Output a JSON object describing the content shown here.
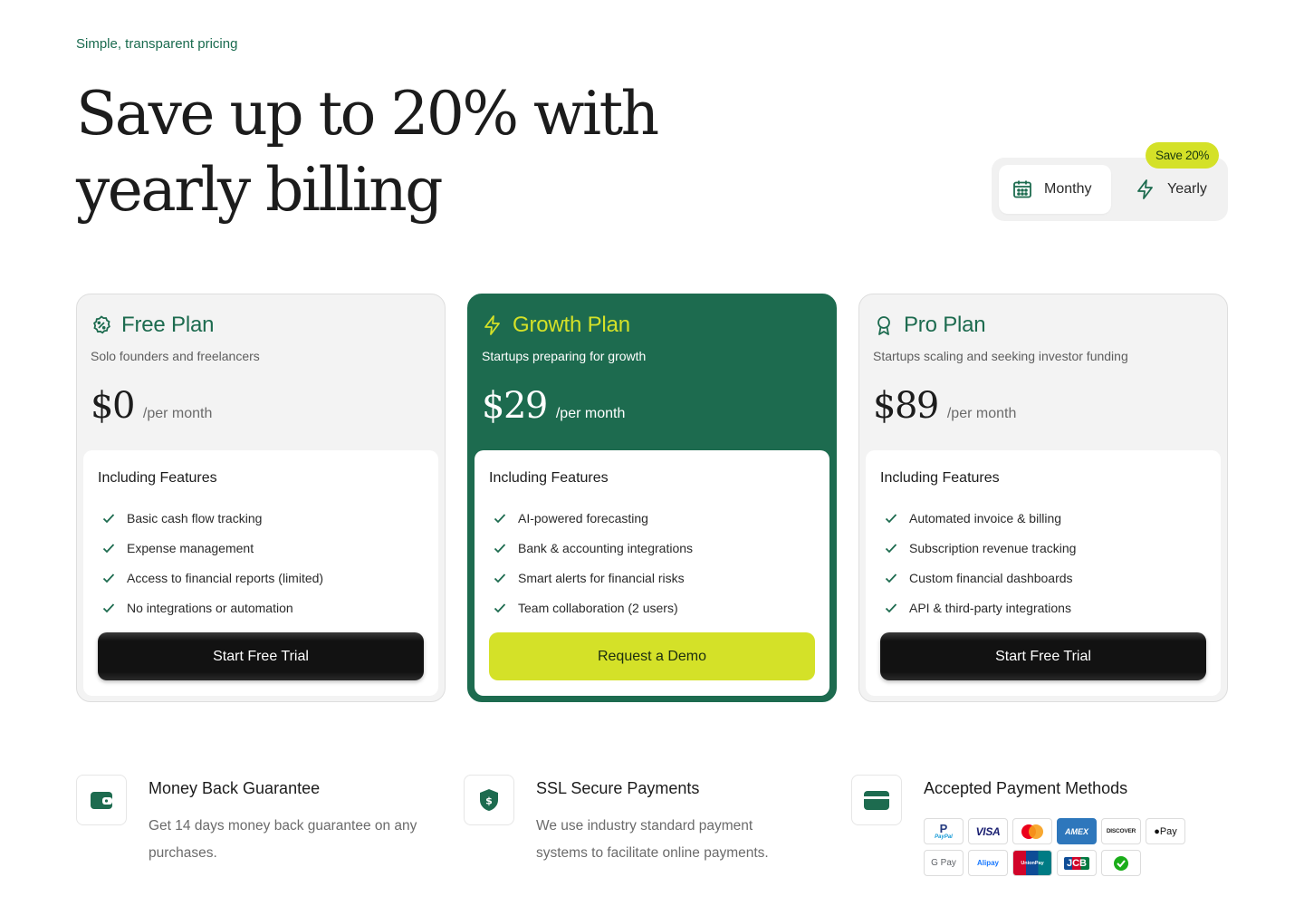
{
  "header": {
    "eyebrow": "Simple, transparent pricing",
    "title_line1": "Save up to 20% with",
    "title_line2": "yearly billing"
  },
  "billing_toggle": {
    "monthly_label": "Monthy",
    "yearly_label": "Yearly",
    "badge": "Save 20%",
    "selected": "Monthy"
  },
  "plans": [
    {
      "name": "Free Plan",
      "icon": "badge-percent-icon",
      "description": "Solo founders and freelancers",
      "price": "$0",
      "period": "/per month",
      "features_title": "Including Features",
      "features": [
        "Basic cash flow tracking",
        "Expense management",
        "Access to financial reports (limited)",
        "No integrations or automation"
      ],
      "cta": "Start Free Trial"
    },
    {
      "name": "Growth Plan",
      "icon": "lightning-icon",
      "description": "Startups preparing for growth",
      "price": "$29",
      "period": "/per month",
      "features_title": "Including Features",
      "features": [
        "AI-powered forecasting",
        "Bank & accounting integrations",
        "Smart alerts for financial risks",
        "Team collaboration (2 users)"
      ],
      "cta": "Request a Demo"
    },
    {
      "name": "Pro Plan",
      "icon": "award-icon",
      "description": "Startups scaling and seeking investor funding",
      "price": "$89",
      "period": "/per month",
      "features_title": "Including Features",
      "features": [
        "Automated invoice & billing",
        "Subscription revenue tracking",
        "Custom financial dashboards",
        "API & third-party integrations"
      ],
      "cta": "Start Free Trial"
    }
  ],
  "info": {
    "money": {
      "title": "Money Back Guarantee",
      "text": "Get 14 days money back guarantee on any purchases."
    },
    "ssl": {
      "title": "SSL Secure Payments",
      "text": "We use industry standard payment systems to facilitate online payments."
    },
    "pay": {
      "title": "Accepted Payment Methods",
      "methods": [
        {
          "name": "PayPal",
          "label": "PayPal"
        },
        {
          "name": "Visa",
          "label": "VISA"
        },
        {
          "name": "Mastercard",
          "label": ""
        },
        {
          "name": "Amex",
          "label": "AMEX"
        },
        {
          "name": "Discover",
          "label": "DISCOVER"
        },
        {
          "name": "Apple Pay",
          "label": "Pay"
        },
        {
          "name": "Google Pay",
          "label": "G Pay"
        },
        {
          "name": "Alipay",
          "label": "Alipay"
        },
        {
          "name": "UnionPay",
          "label": "UnionPay"
        },
        {
          "name": "JCB",
          "label": "JCB"
        },
        {
          "name": "WeChat Pay",
          "label": ""
        }
      ]
    }
  },
  "colors": {
    "brand_green": "#1d6b4f",
    "accent_lime": "#d4e128",
    "cta_dark": "#121212"
  }
}
